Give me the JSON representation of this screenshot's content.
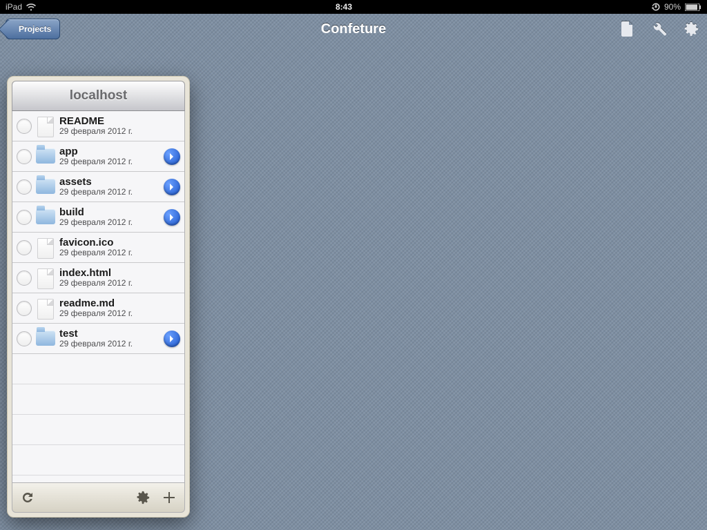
{
  "statusbar": {
    "device": "iPad",
    "time": "8:43",
    "battery": "90%"
  },
  "navbar": {
    "back_label": "Projects",
    "title": "Confeture"
  },
  "panel": {
    "title": "localhost",
    "items": [
      {
        "name": "README",
        "date": "29 февраля 2012 г.",
        "type": "file"
      },
      {
        "name": "app",
        "date": "29 февраля 2012 г.",
        "type": "folder"
      },
      {
        "name": "assets",
        "date": "29 февраля 2012 г.",
        "type": "folder"
      },
      {
        "name": "build",
        "date": "29 февраля 2012 г.",
        "type": "folder"
      },
      {
        "name": "favicon.ico",
        "date": "29 февраля 2012 г.",
        "type": "file"
      },
      {
        "name": "index.html",
        "date": "29 февраля 2012 г.",
        "type": "file"
      },
      {
        "name": "readme.md",
        "date": "29 февраля 2012 г.",
        "type": "file"
      },
      {
        "name": "test",
        "date": "29 февраля 2012 г.",
        "type": "folder"
      }
    ]
  }
}
